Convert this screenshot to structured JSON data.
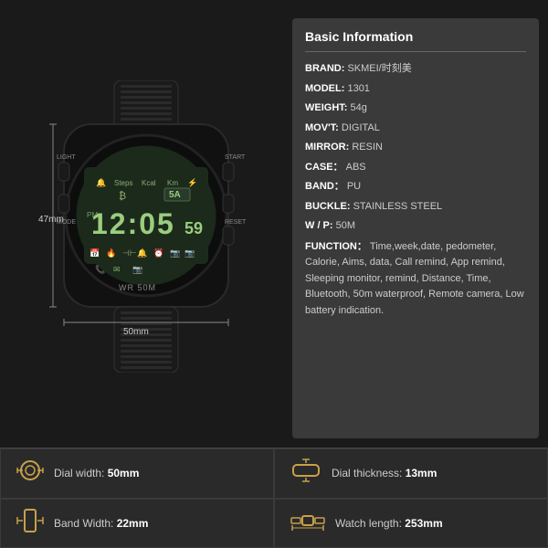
{
  "page": {
    "background": "#1a1a1a"
  },
  "info_panel": {
    "title": "Basic Information",
    "rows": [
      {
        "label": "BRAND:",
        "value": "SKMEI/时刻美"
      },
      {
        "label": "MODEL:",
        "value": "1301"
      },
      {
        "label": "WEIGHT:",
        "value": "54g"
      },
      {
        "label": "MOV'T:",
        "value": "DIGITAL"
      },
      {
        "label": "MIRROR:",
        "value": "RESIN"
      },
      {
        "label": "CASE：",
        "value": "ABS"
      },
      {
        "label": "BAND：",
        "value": "PU"
      },
      {
        "label": "BUCKLE:",
        "value": "STAINLESS STEEL"
      },
      {
        "label": "W / P:",
        "value": "50M"
      },
      {
        "label": "FUNCTION：",
        "value": "Time,week,date, pedometer, Calorie, Aims, data, Call remind, App remind, Sleeping monitor, remind, Distance, Time, Bluetooth, 50m waterproof, Remote camera, Low battery indication."
      }
    ]
  },
  "dimensions": {
    "height_label": "47mm",
    "width_label": "50mm"
  },
  "specs": [
    {
      "icon": "⌚",
      "label": "Dial width:",
      "value": "50mm"
    },
    {
      "icon": "📏",
      "label": "Dial thickness:",
      "value": "13mm"
    },
    {
      "icon": "📐",
      "label": "Band Width:",
      "value": "22mm"
    },
    {
      "icon": "🔗",
      "label": "Watch length:",
      "value": "253mm"
    }
  ]
}
